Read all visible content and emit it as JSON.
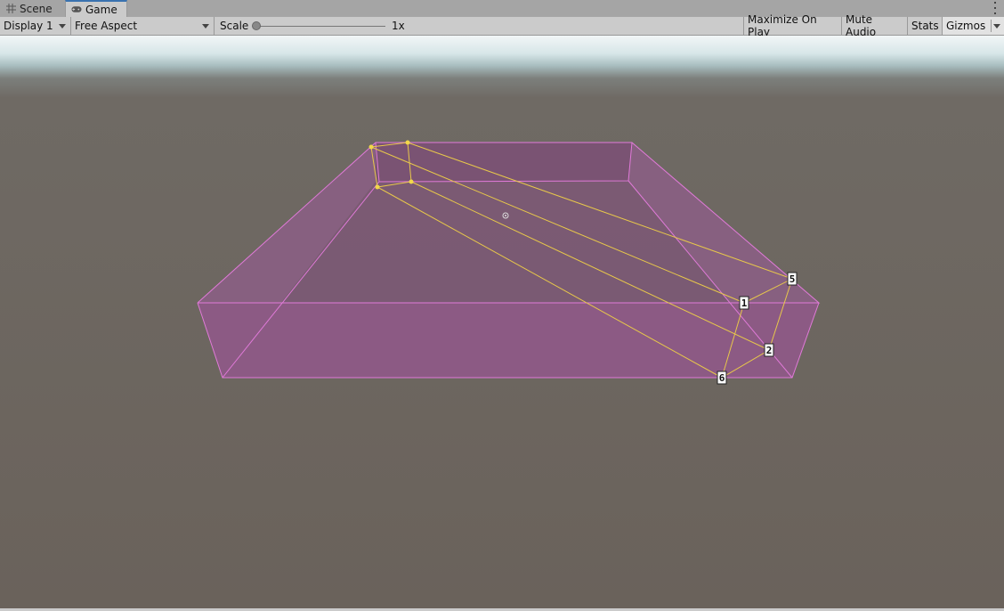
{
  "tabs": [
    {
      "label": "Scene",
      "icon": "grid-icon",
      "active": false
    },
    {
      "label": "Game",
      "icon": "gamepad-icon",
      "active": true
    }
  ],
  "toolbar": {
    "display": "Display 1",
    "aspect": "Free Aspect",
    "scale_label": "Scale",
    "scale_value": "1x",
    "scale_fraction": 0.0,
    "maximize_label": "Maximize On Play",
    "mute_label": "Mute Audio",
    "stats_label": "Stats",
    "gizmos_label": "Gizmos"
  },
  "scene": {
    "point_labels": [
      "1",
      "5",
      "2",
      "6"
    ],
    "colors": {
      "box_fill": "#8e5a86",
      "box_edge": "#e07ad8",
      "gizmo_line": "#e8c84a",
      "ground": "#6a625b",
      "sky": "#f2f6f7"
    }
  }
}
